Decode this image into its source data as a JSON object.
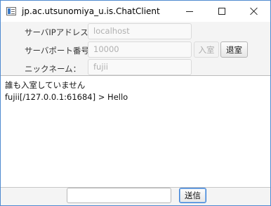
{
  "window": {
    "title": "jp.ac.utsunomiya_u.is.ChatClient"
  },
  "form": {
    "server_ip_label": "サーバIPアドレス：",
    "server_ip_value": "localhost",
    "server_port_label": "サーバポート番号：",
    "server_port_value": "10000",
    "nickname_label": "ニックネーム：",
    "nickname_value": "fujii",
    "enter_button": "入室",
    "exit_button": "退室"
  },
  "log": {
    "lines": [
      "誰も入室していません",
      "fujii[/127.0.0.1:61684] > Hello"
    ]
  },
  "footer": {
    "message_value": "",
    "send_button": "送信"
  }
}
